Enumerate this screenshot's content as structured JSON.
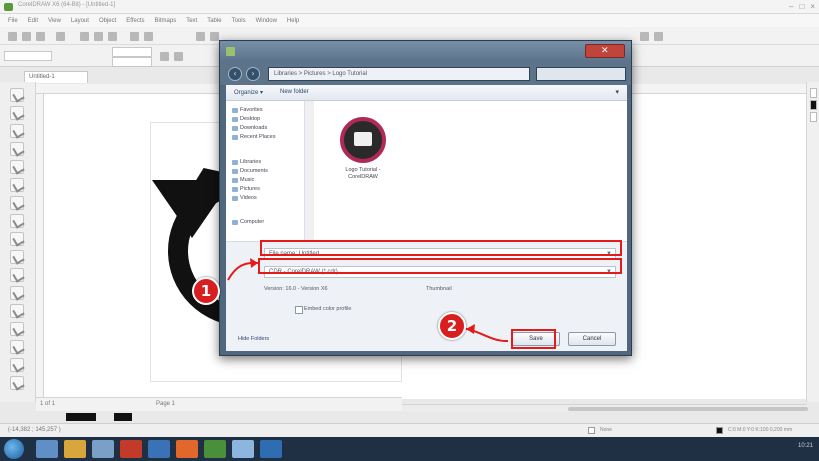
{
  "app": {
    "title": "CorelDRAW X6 (64-Bit) - [Untitled-1]",
    "menus": [
      "File",
      "Edit",
      "View",
      "Layout",
      "Object",
      "Effects",
      "Bitmaps",
      "Text",
      "Table",
      "Tools",
      "Window",
      "Help"
    ],
    "doc_tab": "Untitled-1",
    "page_nav_text": "1 of 1",
    "page_label": "Page 1",
    "status_text": "(-14,382 ; 145,257 )",
    "fill_status": "None",
    "outline_status": "C:0 M:0 Y:0 K:100  0,200 mm"
  },
  "dialog": {
    "address": "Libraries > Pictures > Logo Tutorial",
    "organize_label": "Organize ▾",
    "new_folder_label": "New folder",
    "views_label": "▾",
    "nav_items": [
      "Favorites",
      "Desktop",
      "Downloads",
      "Recent Places",
      "Libraries",
      "Documents",
      "Music",
      "Pictures",
      "Videos",
      "Computer"
    ],
    "file": {
      "name": "Logo Tutorial - CorelDRAW",
      "icon": "coreldraw-file-icon"
    },
    "filename_label": "File name:",
    "filename_value": "Untitled",
    "filetype_value": "CDR - CorelDRAW (*.cdr)",
    "version_label": "Version: 16.0 - Version X6",
    "thumbnail_label": "Thumbnail",
    "embed_label": "Embed color profile",
    "hide_folders": "Hide Folders",
    "save_button": "Save",
    "cancel_button": "Cancel"
  },
  "annotations": {
    "step1": "1",
    "step2": "2",
    "color": "#e31b1b"
  },
  "taskbar": {
    "clock": "10:21"
  }
}
